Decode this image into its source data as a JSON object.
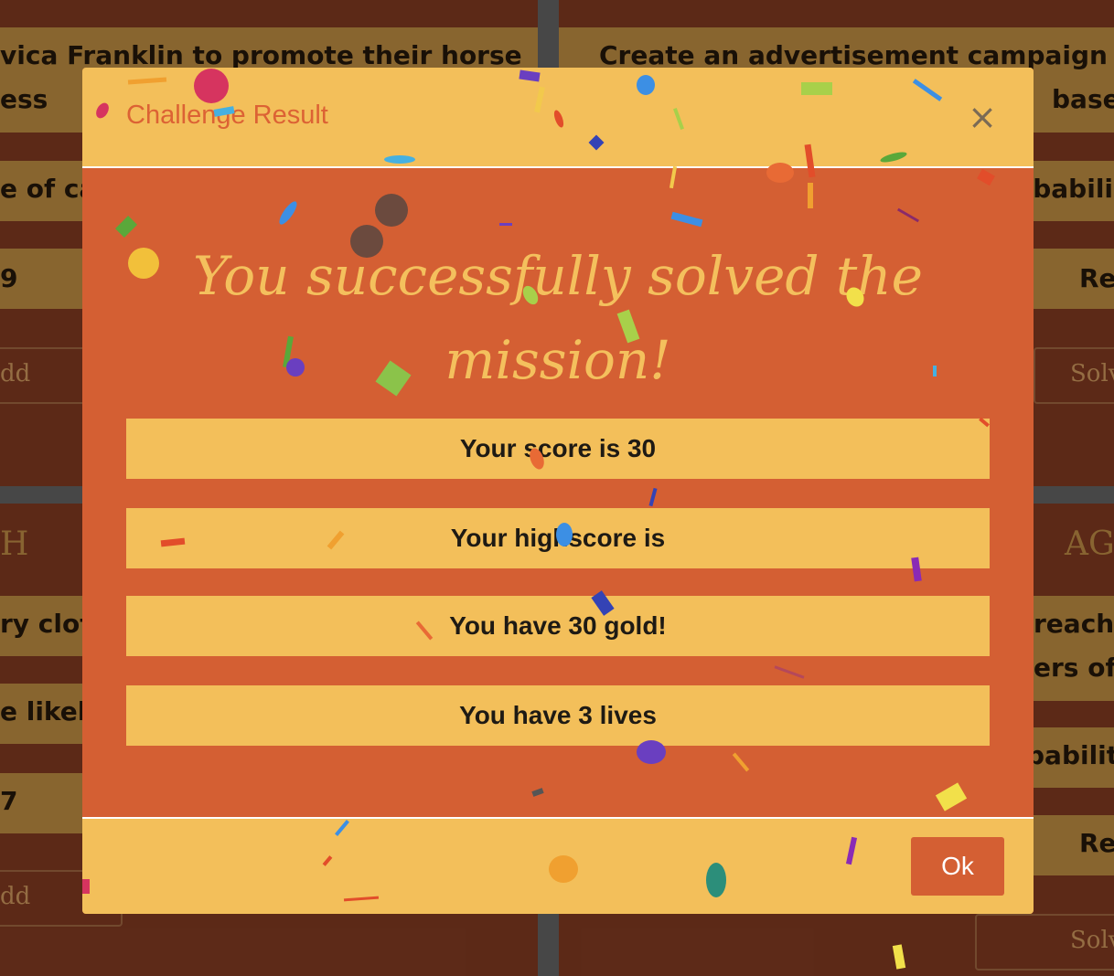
{
  "background": {
    "cards": [
      {
        "text_line1": "vica Franklin to promote their horse",
        "text_line2": "ess",
        "band_text": "e of ca",
        "value": "9",
        "button_label": "dd"
      },
      {
        "text_line1": "Create an advertisement campaign fo",
        "text_line2": "base",
        "band_text": "obabili",
        "value": "Re",
        "button_label": "Solv"
      },
      {
        "heading": "H",
        "text_line1": "ry clot",
        "band_text": "e likel",
        "value": "7",
        "button_label": "dd"
      },
      {
        "heading": "AG",
        "text_line1": "reach",
        "text_line2": "ers of",
        "band_text": "bability:",
        "value": "Re",
        "button_label": "Solv"
      }
    ]
  },
  "modal": {
    "title": "Challenge Result",
    "close_symbol": "×",
    "headline": "You successfully solved the mission!",
    "stats": [
      {
        "text": "Your score is 30"
      },
      {
        "text": "Your highscore is"
      },
      {
        "text": "You have 30 gold!"
      },
      {
        "text": "You have 3 lives"
      }
    ],
    "ok_label": "Ok"
  },
  "colors": {
    "modal_header_bg": "#f3bf5a",
    "modal_body_bg": "#d45f33",
    "title_color": "#dc6234",
    "headline_color": "#f4c05d",
    "page_card_bg": "#71331d"
  },
  "icons": {
    "close": "close-icon"
  }
}
